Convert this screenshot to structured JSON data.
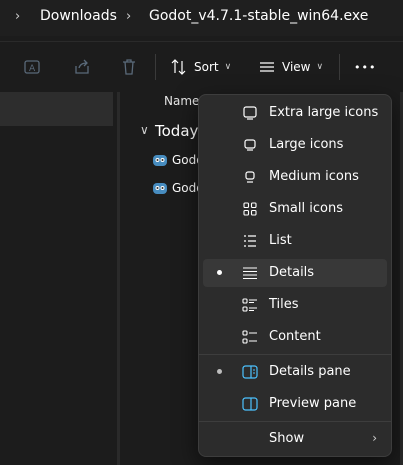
{
  "breadcrumb": {
    "items": [
      "Downloads",
      "Godot_v4.7.1-stable_win64.exe"
    ]
  },
  "toolbar": {
    "sort_label": "Sort",
    "view_label": "View",
    "more_label": "•••"
  },
  "filelist": {
    "column_name": "Name",
    "group_label": "Today",
    "files": [
      {
        "name": "Godo",
        "icon": "godot-icon"
      },
      {
        "name": "Godo",
        "icon": "godot-icon"
      }
    ]
  },
  "view_menu": {
    "items": [
      {
        "label": "Extra large icons",
        "icon": "monitor-icon",
        "checked": false
      },
      {
        "label": "Large icons",
        "icon": "monitor-icon",
        "checked": false
      },
      {
        "label": "Medium icons",
        "icon": "monitor-icon",
        "checked": false
      },
      {
        "label": "Small icons",
        "icon": "grid-icon",
        "checked": false
      },
      {
        "label": "List",
        "icon": "list-icon",
        "checked": false
      },
      {
        "label": "Details",
        "icon": "details-icon",
        "checked": true
      },
      {
        "label": "Tiles",
        "icon": "tiles-icon",
        "checked": false
      },
      {
        "label": "Content",
        "icon": "content-icon",
        "checked": false
      }
    ],
    "pane_items": [
      {
        "label": "Details pane",
        "icon": "details-pane-icon",
        "checked": true
      },
      {
        "label": "Preview pane",
        "icon": "preview-pane-icon",
        "checked": false
      }
    ],
    "show_label": "Show"
  },
  "colors": {
    "background": "#1c1c1c",
    "menu_bg": "#2c2c2c",
    "accent": "#4cc2ff"
  }
}
